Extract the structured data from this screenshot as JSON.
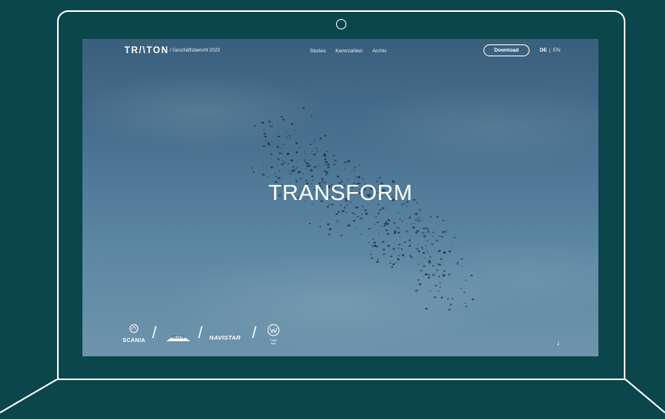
{
  "header": {
    "logo": "TR/\\TON",
    "subtitle": "/ Geschäftsbericht 2023",
    "nav": [
      "Stories",
      "Kennzahlen",
      "Archiv"
    ],
    "download_label": "Download",
    "lang_de": "DE",
    "lang_sep": "|",
    "lang_en": "EN"
  },
  "hero": {
    "title": "TRANSFORM"
  },
  "brands": {
    "scania": "SCANIA",
    "man": "MAN",
    "navistar": "NAVISTAR",
    "vw_line1": "Truck",
    "vw_line2": "Bus"
  },
  "scroll_icon": "arrow-down-icon",
  "colors": {
    "background": "#0a464b",
    "frame": "#ffffff",
    "sky_top": "#3a5f7d",
    "sky_bottom": "#6d94ac"
  }
}
